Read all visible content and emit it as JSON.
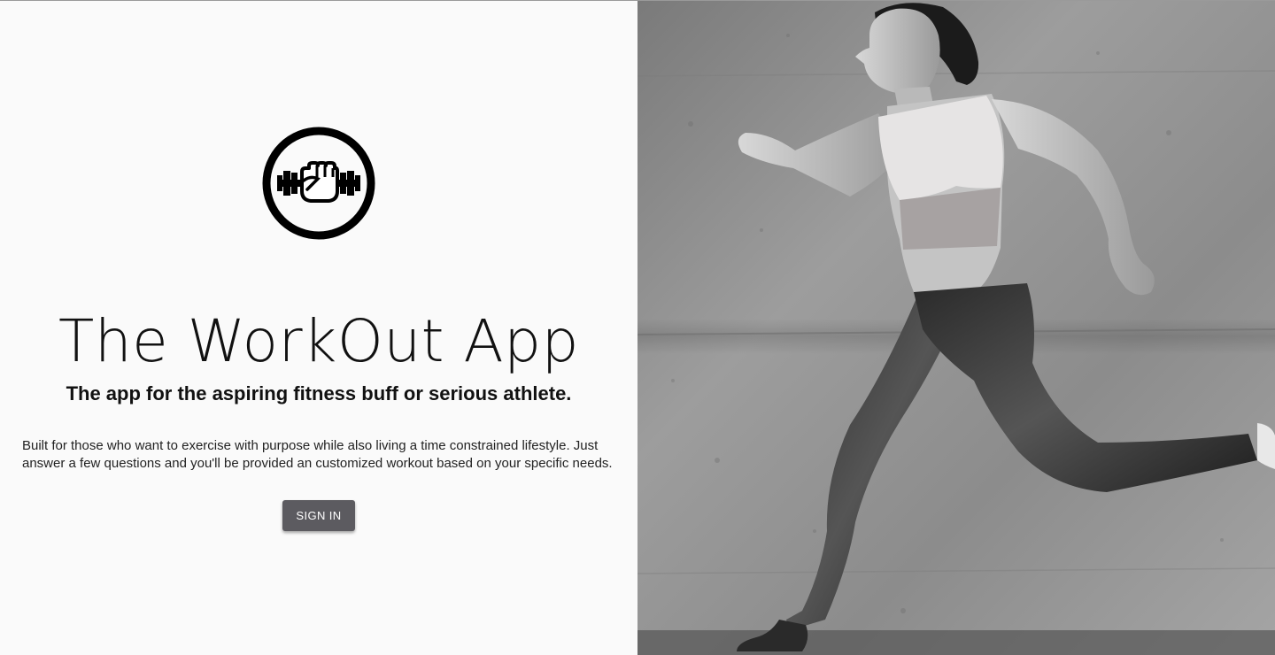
{
  "app": {
    "title": "The WorkOut App",
    "tagline": "The app for the aspiring fitness buff or serious athlete.",
    "description": "Built for those who want to exercise with purpose while also living a time constrained lifestyle. Just answer a few questions and you'll be provided an customized workout based on your specific needs.",
    "signin_label": "SIGN IN",
    "logo_icon": "fist-dumbbell-icon"
  },
  "hero": {
    "image_subject": "black-and-white photo of a woman running against a concrete wall"
  },
  "colors": {
    "button_bg": "#5c5b60",
    "button_text": "#ffffff",
    "page_bg": "#fafafa",
    "text": "#111111"
  }
}
